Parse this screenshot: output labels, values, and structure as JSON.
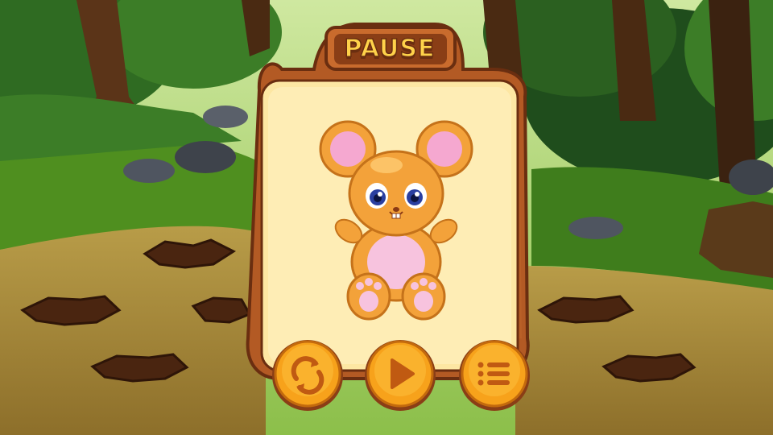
{
  "pause_panel": {
    "title": "PAUSE",
    "character": "orange-mouse",
    "buttons": [
      {
        "id": "restart",
        "icon": "restart-icon"
      },
      {
        "id": "play",
        "icon": "play-icon"
      },
      {
        "id": "menu",
        "icon": "menu-list-icon"
      }
    ]
  },
  "colors": {
    "panel_fill": "#fde7a3",
    "wood": "#b35a24",
    "button_fill": "#f7a21b",
    "title_text": "#ffd24a",
    "grass": "#4f8f1f",
    "dirt": "#a98a3a"
  }
}
